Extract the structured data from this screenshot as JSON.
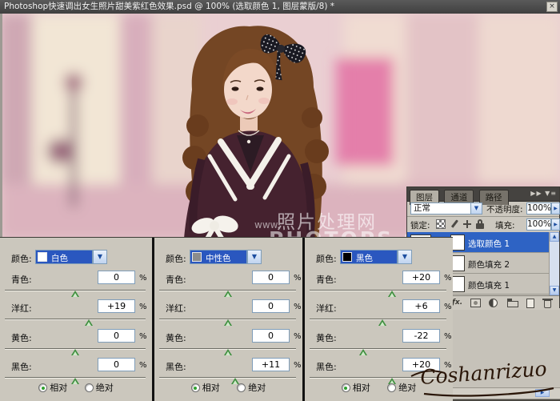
{
  "title_bar": {
    "title": "Photoshop快速调出女生照片甜美紫红色效果.psd @ 100% (选取颜色 1, 图层蒙版/8) *",
    "close_label": "×"
  },
  "photo": {
    "watermark_prefix": "www.",
    "watermark_site_cn": "照片处理网",
    "watermark_site_en": "PHOTOPS.COM"
  },
  "layers_panel": {
    "tabs": [
      {
        "label": "图层"
      },
      {
        "label": "通道"
      },
      {
        "label": "路径"
      }
    ],
    "blend_mode_value": "正常",
    "opacity_label": "不透明度:",
    "opacity_value": "100%",
    "lock_label": "锁定:",
    "fill_label": "填充:",
    "fill_value": "100%",
    "layers": [
      {
        "name": "选取颜色 1"
      },
      {
        "name": "颜色填充 2"
      },
      {
        "name": "颜色填充 1"
      }
    ]
  },
  "selective_color_panels": [
    {
      "color_label": "颜色:",
      "color_value": "白色",
      "swatch_color": "#ffffff",
      "rows": [
        {
          "label": "青色:",
          "value": "0",
          "pos": "50%"
        },
        {
          "label": "洋红:",
          "value": "+19",
          "pos": "59.5%"
        },
        {
          "label": "黄色:",
          "value": "0",
          "pos": "50%"
        },
        {
          "label": "黑色:",
          "value": "0",
          "pos": "50%"
        }
      ],
      "relative_label": "相对",
      "absolute_label": "绝对"
    },
    {
      "color_label": "颜色:",
      "color_value": "中性色",
      "swatch_color": "#8c8c8c",
      "rows": [
        {
          "label": "青色:",
          "value": "0",
          "pos": "50%"
        },
        {
          "label": "洋红:",
          "value": "0",
          "pos": "50%"
        },
        {
          "label": "黄色:",
          "value": "0",
          "pos": "50%"
        },
        {
          "label": "黑色:",
          "value": "+11",
          "pos": "55.5%"
        }
      ],
      "relative_label": "相对",
      "absolute_label": "绝对"
    },
    {
      "color_label": "颜色:",
      "color_value": "黑色",
      "swatch_color": "#000000",
      "rows": [
        {
          "label": "青色:",
          "value": "+20",
          "pos": "60%"
        },
        {
          "label": "洋红:",
          "value": "+6",
          "pos": "53%"
        },
        {
          "label": "黄色:",
          "value": "-22",
          "pos": "39%"
        },
        {
          "label": "黑色:",
          "value": "+20",
          "pos": "60%"
        }
      ],
      "relative_label": "相对",
      "absolute_label": "绝对"
    }
  ],
  "percent_sign": "%",
  "signature_text": "Coshanrizuo",
  "colors": {
    "selection_blue": "#2e63c4",
    "panel_background": "#cbc7bd",
    "slider_thumb_green": "#3e8e3e",
    "watermark_pink": "#e0609c"
  }
}
